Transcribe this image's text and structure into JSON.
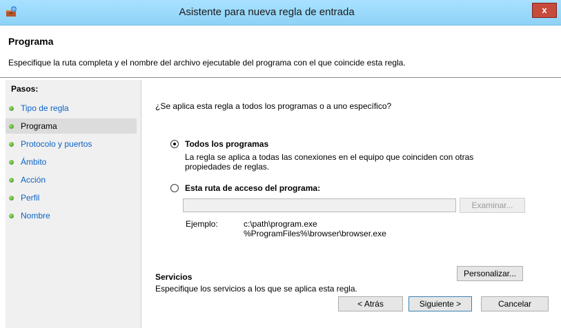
{
  "window": {
    "title": "Asistente para nueva regla de entrada",
    "close_glyph": "x",
    "icon": "firewall-shield-icon"
  },
  "header": {
    "title": "Programa",
    "description": "Especifique la ruta completa y el nombre del archivo ejecutable del programa con el que coincide esta regla."
  },
  "steps": {
    "heading": "Pasos:",
    "items": [
      {
        "label": "Tipo de regla",
        "current": false
      },
      {
        "label": "Programa",
        "current": true
      },
      {
        "label": "Protocolo y puertos",
        "current": false
      },
      {
        "label": "Ámbito",
        "current": false
      },
      {
        "label": "Acción",
        "current": false
      },
      {
        "label": "Perfil",
        "current": false
      },
      {
        "label": "Nombre",
        "current": false
      }
    ]
  },
  "content": {
    "question": "¿Se aplica esta regla a todos los programas o a uno específico?",
    "option_all": {
      "label": "Todos los programas",
      "description": "La regla se aplica a todas las conexiones en el equipo que coinciden con otras propiedades de reglas.",
      "selected": true
    },
    "option_path": {
      "label": "Esta ruta de acceso del programa:",
      "selected": false,
      "value": "",
      "browse_label": "Examinar..."
    },
    "example": {
      "label": "Ejemplo:",
      "line1": "c:\\path\\program.exe",
      "line2": "%ProgramFiles%\\browser\\browser.exe"
    },
    "services": {
      "title": "Servicios",
      "description": "Especifique los servicios a los que se aplica esta regla.",
      "customize_label": "Personalizar..."
    }
  },
  "footer": {
    "back_label": "< Atrás",
    "next_label": "Siguiente >",
    "cancel_label": "Cancelar"
  },
  "colors": {
    "titlebar": "#a8e1ff",
    "close": "#c74b3c",
    "step_link": "#0b63c4",
    "step_bullet": "#3a9a25",
    "steps_panel": "#f0f0f0"
  }
}
